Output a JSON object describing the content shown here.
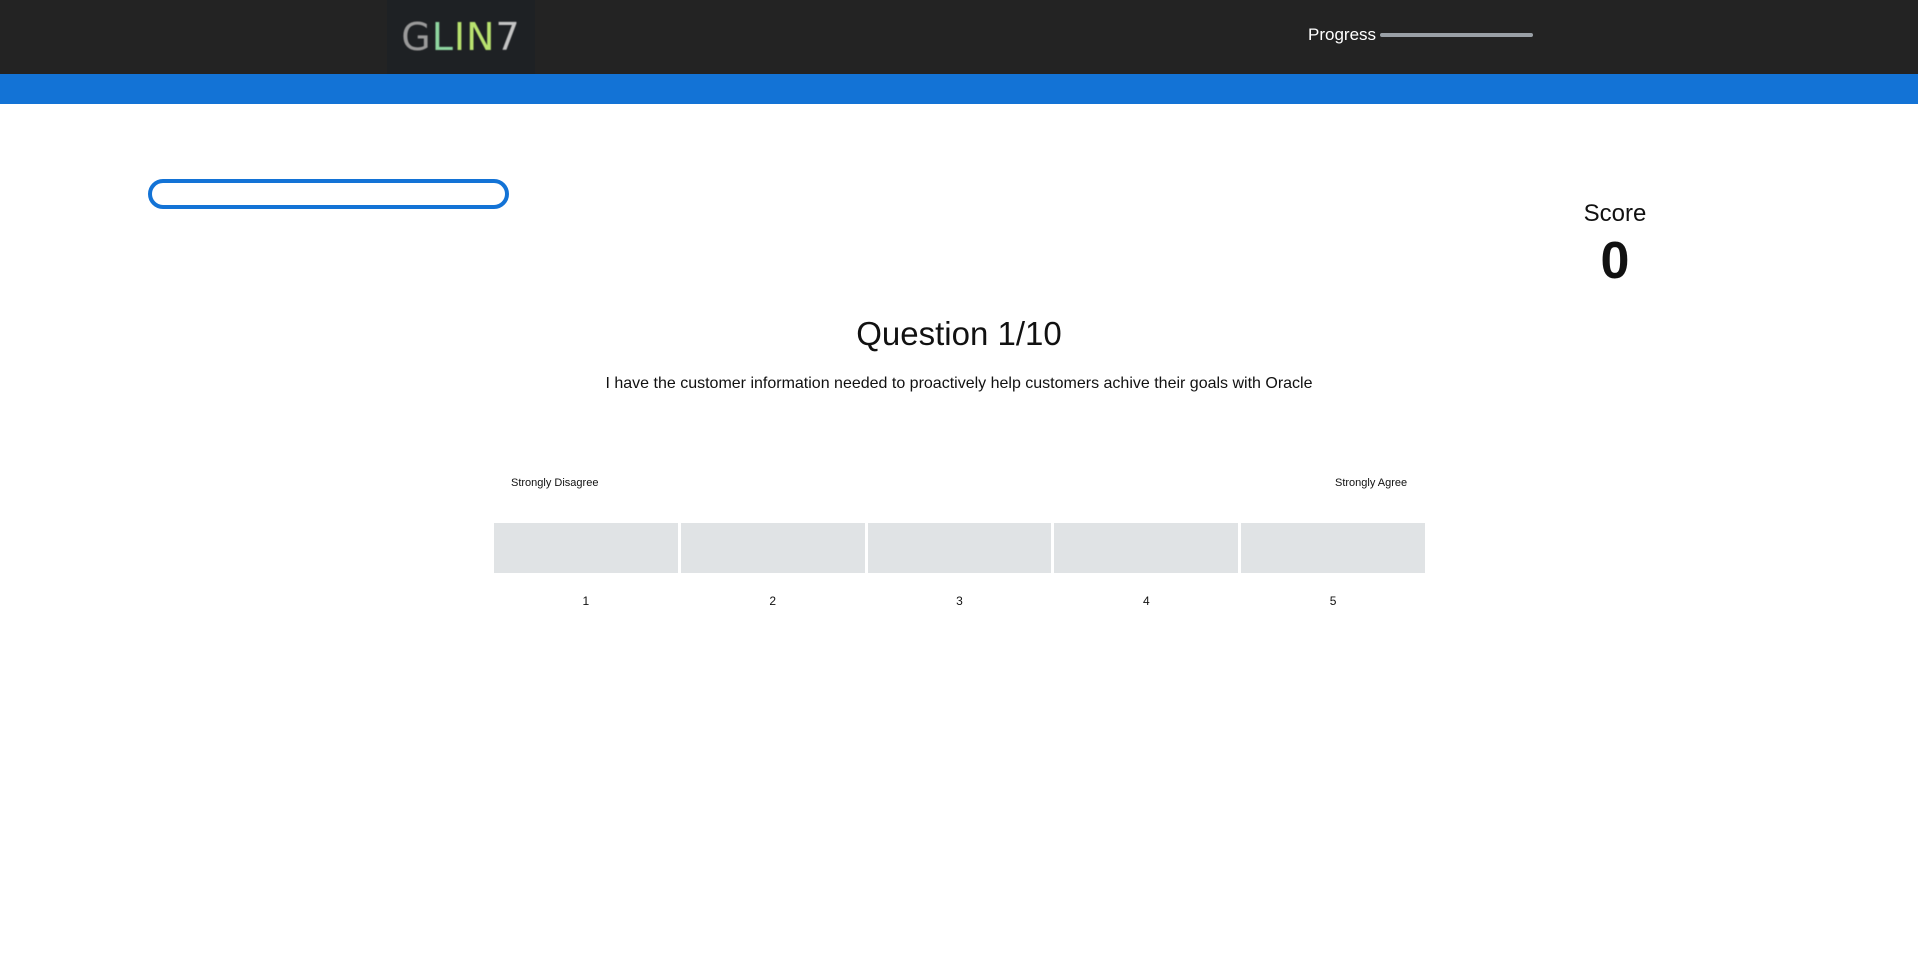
{
  "header": {
    "logo": {
      "text_parts": [
        "G",
        "L",
        "IN",
        "7"
      ]
    },
    "progress": {
      "label": "Progress",
      "value": 0.0
    }
  },
  "colors": {
    "topbar": "#232323",
    "accent": "#1373d6",
    "option_bg": "#e0e3e5"
  },
  "form": {
    "name_input": {
      "value": "",
      "placeholder": ""
    }
  },
  "score": {
    "label": "Score",
    "value": "0"
  },
  "question": {
    "title": "Question 1/10",
    "text": "I have the customer information needed to proactively help customers achive their goals with Oracle"
  },
  "scale": {
    "min_label": "Strongly Disagree",
    "max_label": "Strongly Agree",
    "options": [
      "1",
      "2",
      "3",
      "4",
      "5"
    ]
  }
}
